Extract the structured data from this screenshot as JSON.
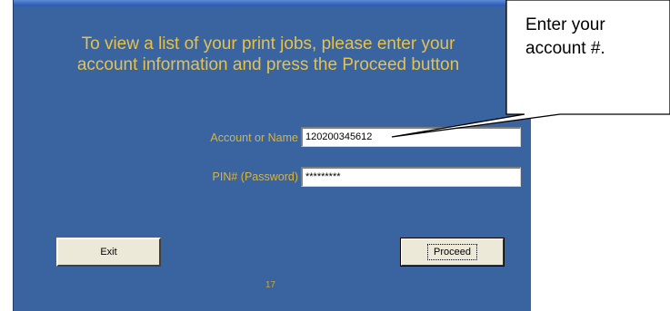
{
  "window": {
    "heading_line1": "To view a list of your print jobs, please enter your",
    "heading_line2": "account information and press the Proceed button",
    "account_label": "Account or Name",
    "account_value": "120200345612",
    "pin_label": "PIN# (Password)",
    "pin_value": "*********",
    "exit_label": "Exit",
    "proceed_label": "Proceed",
    "page_number": "17"
  },
  "callout": {
    "line1": "Enter your",
    "line2": "account #."
  },
  "colors": {
    "window_bg": "#3a64a0",
    "heading_text": "#e6c24a",
    "label_text": "#d4b347",
    "button_face": "#ece9d8"
  }
}
